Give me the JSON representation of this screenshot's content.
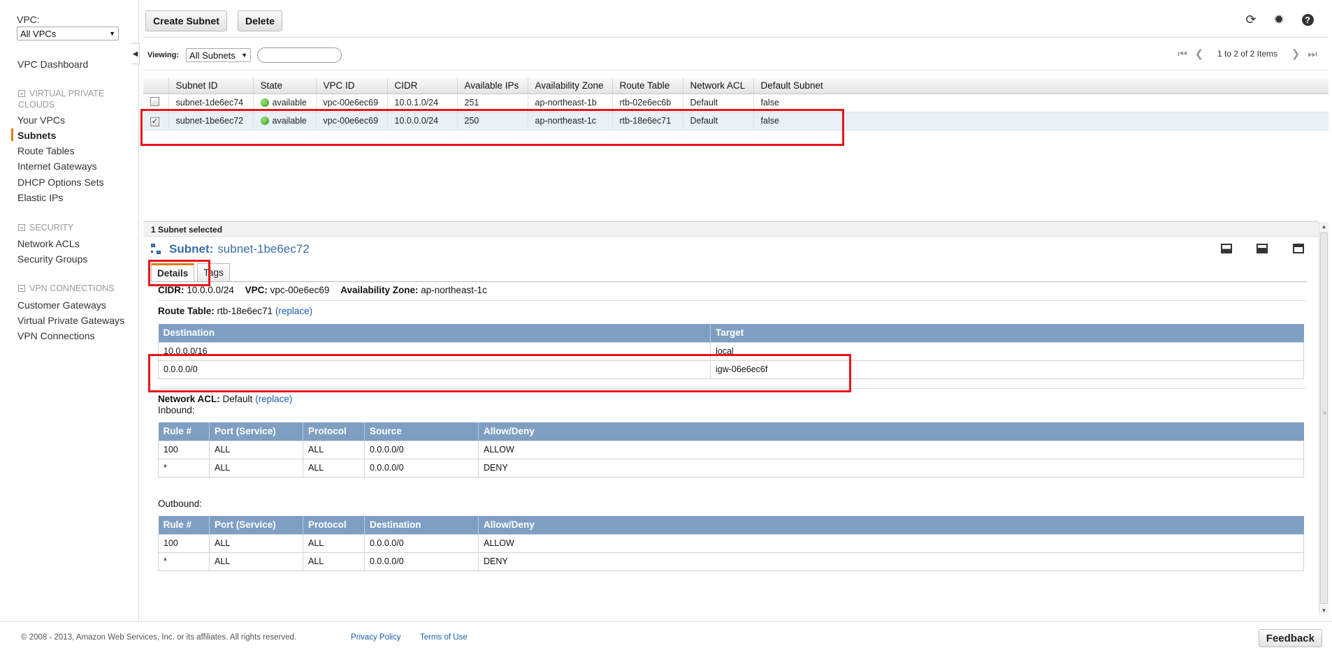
{
  "sidebar": {
    "vpc_label": "VPC:",
    "vpc_select": "All VPCs",
    "dashboard": "VPC Dashboard",
    "section_vpc": "VIRTUAL PRIVATE CLOUDS",
    "items_vpc": [
      "Your VPCs",
      "Subnets",
      "Route Tables",
      "Internet Gateways",
      "DHCP Options Sets",
      "Elastic IPs"
    ],
    "section_security": "SECURITY",
    "items_security": [
      "Network ACLs",
      "Security Groups"
    ],
    "section_vpn": "VPN CONNECTIONS",
    "items_vpn": [
      "Customer Gateways",
      "Virtual Private Gateways",
      "VPN Connections"
    ],
    "active_item": "Subnets"
  },
  "toolbar": {
    "create_label": "Create Subnet",
    "delete_label": "Delete",
    "viewing_label": "Viewing:",
    "viewing_value": "All Subnets",
    "pager_text": "1 to 2 of 2 Items"
  },
  "grid": {
    "columns": [
      "Subnet ID",
      "State",
      "VPC ID",
      "CIDR",
      "Available IPs",
      "Availability Zone",
      "Route Table",
      "Network ACL",
      "Default Subnet"
    ],
    "rows": [
      {
        "checked": false,
        "subnet_id": "subnet-1de6ec74",
        "state": "available",
        "vpc_id": "vpc-00e6ec69",
        "cidr": "10.0.1.0/24",
        "available_ips": "251",
        "az": "ap-northeast-1b",
        "route_table": "rtb-02e6ec6b",
        "network_acl": "Default",
        "default_subnet": "false"
      },
      {
        "checked": true,
        "subnet_id": "subnet-1be6ec72",
        "state": "available",
        "vpc_id": "vpc-00e6ec69",
        "cidr": "10.0.0.0/24",
        "available_ips": "250",
        "az": "ap-northeast-1c",
        "route_table": "rtb-18e6ec71",
        "network_acl": "Default",
        "default_subnet": "false"
      }
    ]
  },
  "detail": {
    "selection_text": "1 Subnet selected",
    "title_keyword": "Subnet:",
    "title_value": "subnet-1be6ec72",
    "tabs": [
      "Details",
      "Tags"
    ],
    "cidr_label": "CIDR:",
    "cidr": "10.0.0.0/24",
    "vpc_label": "VPC:",
    "vpc": "vpc-00e6ec69",
    "az_label": "Availability Zone:",
    "az": "ap-northeast-1c",
    "route_table_label": "Route Table:",
    "route_table": "rtb-18e6ec71",
    "replace_link": "(replace)",
    "routes": {
      "columns": [
        "Destination",
        "Target"
      ],
      "rows": [
        [
          "10.0.0.0/16",
          "local"
        ],
        [
          "0.0.0.0/0",
          "igw-06e6ec6f"
        ]
      ]
    },
    "acl_label": "Network ACL:",
    "acl": "Default",
    "inbound_label": "Inbound:",
    "inbound": {
      "columns": [
        "Rule #",
        "Port (Service)",
        "Protocol",
        "Source",
        "Allow/Deny"
      ],
      "rows": [
        [
          "100",
          "ALL",
          "ALL",
          "0.0.0.0/0",
          "ALLOW"
        ],
        [
          "*",
          "ALL",
          "ALL",
          "0.0.0.0/0",
          "DENY"
        ]
      ]
    },
    "outbound_label": "Outbound:",
    "outbound": {
      "columns": [
        "Rule #",
        "Port (Service)",
        "Protocol",
        "Destination",
        "Allow/Deny"
      ],
      "rows": [
        [
          "100",
          "ALL",
          "ALL",
          "0.0.0.0/0",
          "ALLOW"
        ],
        [
          "*",
          "ALL",
          "ALL",
          "0.0.0.0/0",
          "DENY"
        ]
      ]
    }
  },
  "footer": {
    "copyright": "© 2008 - 2013, Amazon Web Services, Inc. or its affiliates. All rights reserved.",
    "privacy": "Privacy Policy",
    "terms": "Terms of Use",
    "feedback": "Feedback"
  },
  "colors": {
    "accent_orange": "#e47911",
    "table_header_blue": "#7f9fc2",
    "link_blue": "#1a5ea8",
    "highlight_red": "#e8141c",
    "status_green": "#2f9e1b"
  },
  "icons": [
    "refresh-icon",
    "gear-icon",
    "help-icon",
    "first-page-icon",
    "prev-page-icon",
    "next-page-icon",
    "last-page-icon",
    "subnet-network-icon",
    "layout-bottom-icon",
    "layout-split-icon",
    "layout-top-icon"
  ]
}
